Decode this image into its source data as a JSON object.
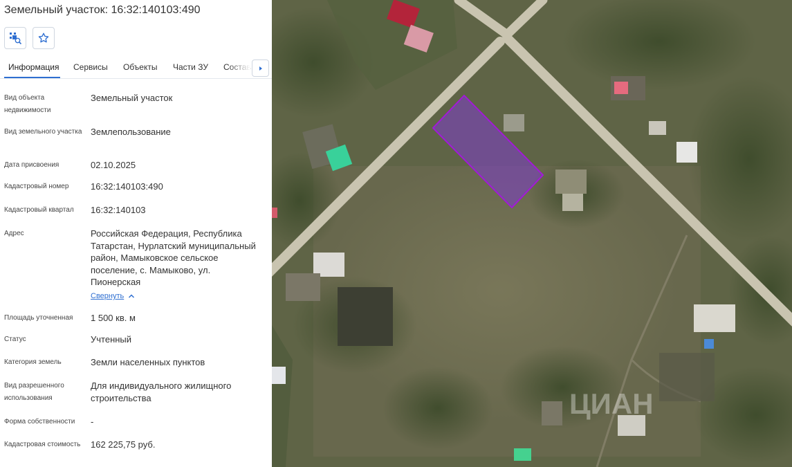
{
  "header": {
    "title": "Земельный участок: 16:32:140103:490",
    "select_icon": "select-area-icon",
    "favorite_icon": "star-icon"
  },
  "tabs": [
    {
      "label": "Информация",
      "active": true
    },
    {
      "label": "Сервисы",
      "active": false
    },
    {
      "label": "Объекты",
      "active": false
    },
    {
      "label": "Части ЗУ",
      "active": false
    },
    {
      "label": "Состав",
      "active": false
    }
  ],
  "tabs_scroll_icon": "chevron-right-icon",
  "info": {
    "object_type": {
      "label": "Вид объекта недвижимости",
      "value": "Земельный участок"
    },
    "land_type": {
      "label": "Вид земельного участка",
      "value": "Землепользование"
    },
    "assign_date": {
      "label": "Дата присвоения",
      "value": "02.10.2025"
    },
    "cadastral_number": {
      "label": "Кадастровый номер",
      "value": "16:32:140103:490"
    },
    "cadastral_quarter": {
      "label": "Кадастровый квартал",
      "value": "16:32:140103"
    },
    "address": {
      "label": "Адрес",
      "value": "Российская Федерация, Республика Татарстан, Нурлатский муниципальный район, Мамыковское сельское поселение, с. Мамыково, ул. Пионерская"
    },
    "collapse_label": "Свернуть",
    "area": {
      "label": "Площадь уточненная",
      "value": "1 500 кв. м"
    },
    "status": {
      "label": "Статус",
      "value": "Учтенный"
    },
    "land_category": {
      "label": "Категория земель",
      "value": "Земли населенных пунктов"
    },
    "permitted_use": {
      "label": "Вид разрешенного использования",
      "value": "Для индивидуального жилищного строительства"
    },
    "ownership_form": {
      "label": "Форма собственности",
      "value": "-"
    },
    "cadastral_value": {
      "label": "Кадастровая стоимость",
      "value": "162 225,75 руб."
    }
  },
  "map": {
    "parcel_color": "#8a2be2",
    "watermark": "ЦИАН"
  }
}
